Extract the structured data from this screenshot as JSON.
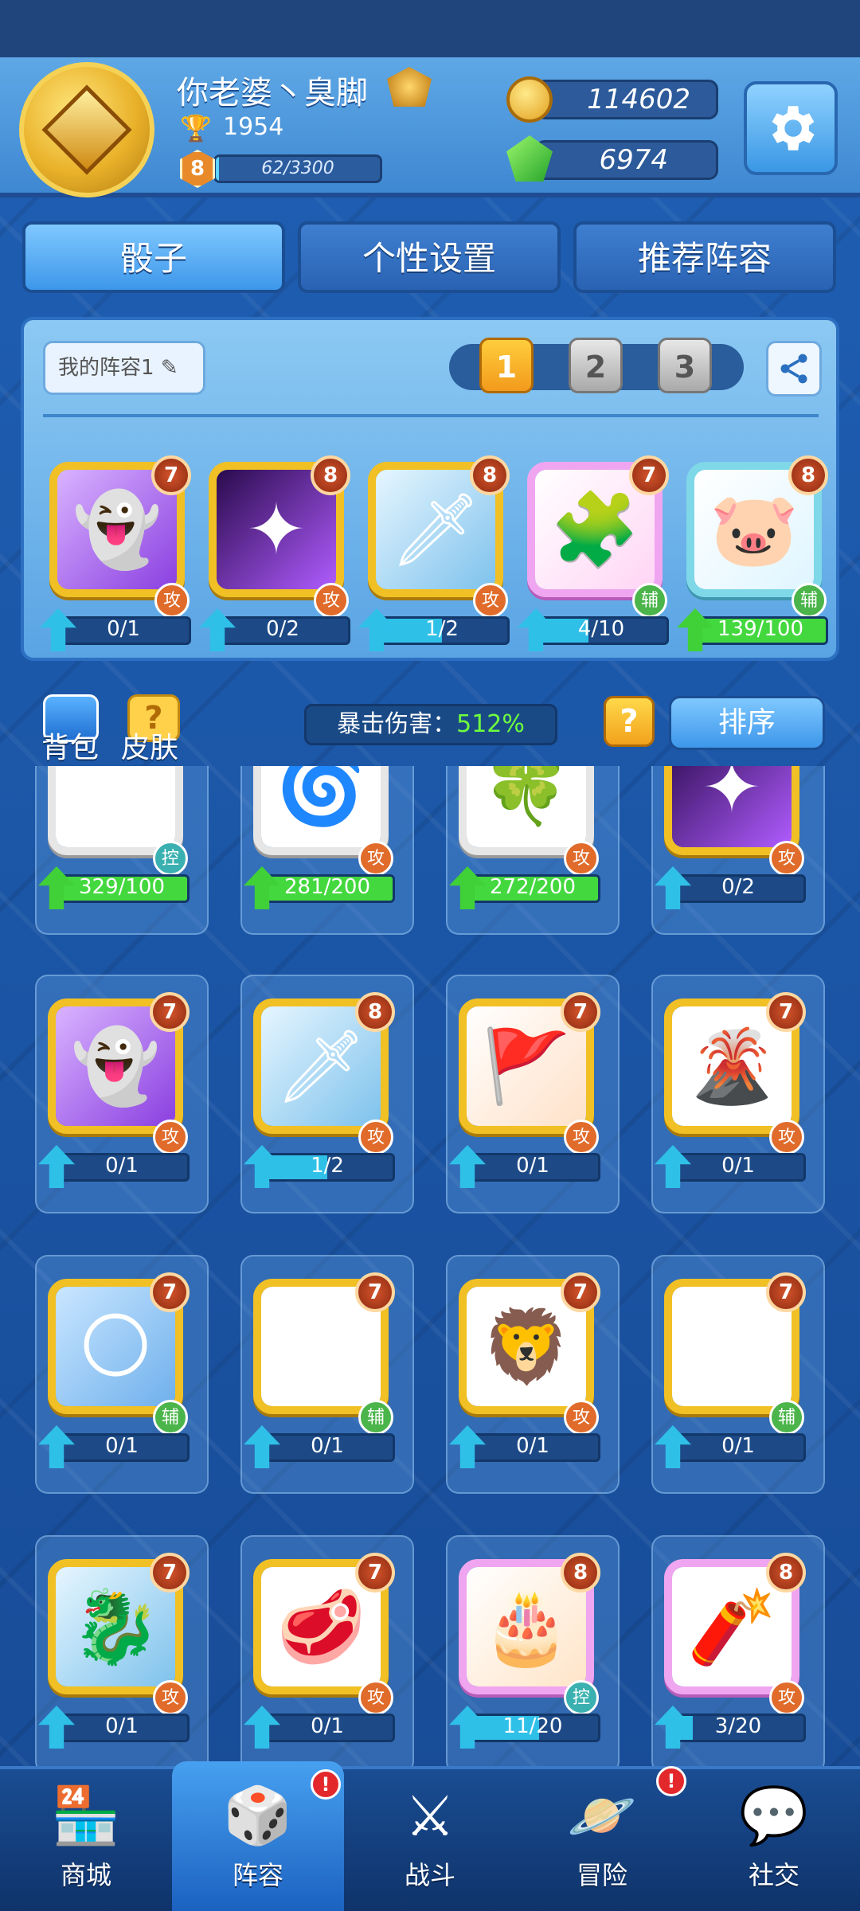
{
  "profile": {
    "name": "你老婆丶臭脚",
    "trophies": "1954",
    "level": "8",
    "xp_text": "62/3300",
    "xp_fraction": 0.019
  },
  "currency": {
    "gold": "114602",
    "gems": "6974"
  },
  "tabs": [
    {
      "label": "骰子",
      "active": true
    },
    {
      "label": "个性设置",
      "active": false
    },
    {
      "label": "推荐阵容",
      "active": false
    }
  ],
  "deck": {
    "name_label": "我的阵容1",
    "slots": [
      "1",
      "2",
      "3"
    ],
    "active_slot": 0,
    "cards": [
      {
        "level": "7",
        "type": "攻",
        "progress": "0/1",
        "fraction": 0.0,
        "art": "purple-ghost",
        "full": false
      },
      {
        "level": "8",
        "type": "攻",
        "progress": "0/2",
        "fraction": 0.0,
        "art": "purple-beam",
        "full": false
      },
      {
        "level": "8",
        "type": "攻",
        "progress": "1/2",
        "fraction": 0.5,
        "art": "ice-sword",
        "full": false
      },
      {
        "level": "7",
        "type": "辅",
        "progress": "4/10",
        "fraction": 0.4,
        "art": "puzzle",
        "full": false
      },
      {
        "level": "8",
        "type": "辅",
        "progress": "139/100",
        "fraction": 1.0,
        "art": "piggy-bank",
        "full": true
      }
    ]
  },
  "middle": {
    "bag_label": "背包",
    "skin_label": "皮肤",
    "crit_label": "暴击伤害：",
    "crit_value": "512%",
    "help_label": "?",
    "sort_label": "排序"
  },
  "collection": [
    {
      "level": "",
      "type": "控",
      "progress": "329/100",
      "fraction": 1.0,
      "art": "snowflake",
      "full": true
    },
    {
      "level": "",
      "type": "攻",
      "progress": "281/200",
      "fraction": 1.0,
      "art": "spiral",
      "full": true
    },
    {
      "level": "",
      "type": "攻",
      "progress": "272/200",
      "fraction": 1.0,
      "art": "clover",
      "full": true
    },
    {
      "level": "",
      "type": "攻",
      "progress": "0/2",
      "fraction": 0.0,
      "art": "purple-beam",
      "full": false
    },
    {
      "level": "7",
      "type": "攻",
      "progress": "0/1",
      "fraction": 0.0,
      "art": "purple-ghost",
      "full": false
    },
    {
      "level": "8",
      "type": "攻",
      "progress": "1/2",
      "fraction": 0.5,
      "art": "ice-sword",
      "full": false
    },
    {
      "level": "7",
      "type": "攻",
      "progress": "0/1",
      "fraction": 0.0,
      "art": "war-banner",
      "full": false
    },
    {
      "level": "7",
      "type": "攻",
      "progress": "0/1",
      "fraction": 0.0,
      "art": "volcano",
      "full": false
    },
    {
      "level": "7",
      "type": "辅",
      "progress": "0/1",
      "fraction": 0.0,
      "art": "moon",
      "full": false
    },
    {
      "level": "7",
      "type": "辅",
      "progress": "0/1",
      "fraction": 0.0,
      "art": "spider-web",
      "full": false
    },
    {
      "level": "7",
      "type": "攻",
      "progress": "0/1",
      "fraction": 0.0,
      "art": "beast-face",
      "full": false
    },
    {
      "level": "7",
      "type": "辅",
      "progress": "0/1",
      "fraction": 0.0,
      "art": "magic-circle",
      "full": false
    },
    {
      "level": "7",
      "type": "攻",
      "progress": "0/1",
      "fraction": 0.0,
      "art": "ice-dragon",
      "full": false
    },
    {
      "level": "7",
      "type": "攻",
      "progress": "0/1",
      "fraction": 0.0,
      "art": "red-claw",
      "full": false
    },
    {
      "level": "8",
      "type": "控",
      "progress": "11/20",
      "fraction": 0.55,
      "art": "cake",
      "full": false
    },
    {
      "level": "8",
      "type": "攻",
      "progress": "3/20",
      "fraction": 0.15,
      "art": "firecracker",
      "full": false
    }
  ],
  "nav": [
    {
      "label": "商城",
      "icon": "shop-icon",
      "badge": ""
    },
    {
      "label": "阵容",
      "icon": "dice-icon",
      "badge": "!",
      "active": true
    },
    {
      "label": "战斗",
      "icon": "swords-icon",
      "badge": ""
    },
    {
      "label": "冒险",
      "icon": "planet-icon",
      "badge": "!"
    },
    {
      "label": "社交",
      "icon": "chat-icon",
      "badge": ""
    }
  ],
  "colors": {
    "accent_blue": "#3d97ea",
    "gold": "#f1c024",
    "attack": "#e06b2a",
    "support": "#4bb54b",
    "control": "#3bb0b0",
    "crit_green": "#6fff3e"
  }
}
